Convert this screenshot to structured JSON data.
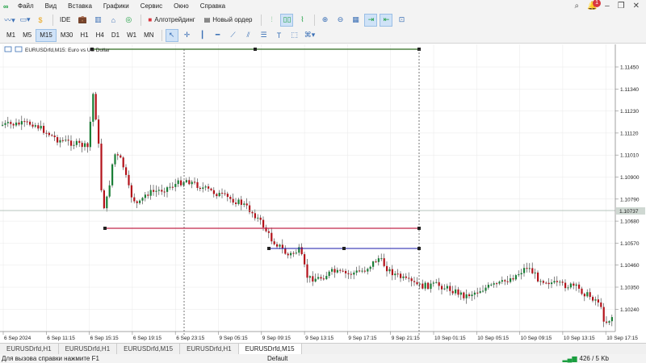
{
  "menu": [
    "Файл",
    "Вид",
    "Вставка",
    "Графики",
    "Сервис",
    "Окно",
    "Справка"
  ],
  "notifications_count": "1",
  "toolbar": {
    "ide_label": "IDE",
    "algo_label": "Алготрейдинг",
    "new_order_label": "Новый ордер"
  },
  "timeframes": [
    "M1",
    "M5",
    "M15",
    "M30",
    "H1",
    "H4",
    "D1",
    "W1",
    "MN"
  ],
  "active_timeframe": "M15",
  "chart": {
    "title": "EURUSDrfd,M15:  Euro vs US Dollar",
    "current_price": "1.10737",
    "price_labels": [
      "1.11450",
      "1.11340",
      "1.11230",
      "1.11120",
      "1.11010",
      "1.10900",
      "1.10790",
      "1.10680",
      "1.10570",
      "1.10460",
      "1.10350",
      "1.10240"
    ],
    "time_labels": [
      "6 Sep 2024",
      "6 Sep 11:15",
      "6 Sep 15:15",
      "6 Sep 19:15",
      "6 Sep 23:15",
      "9 Sep 05:15",
      "9 Sep 09:15",
      "9 Sep 13:15",
      "9 Sep 17:15",
      "9 Sep 21:15",
      "10 Sep 01:15",
      "10 Sep 05:15",
      "10 Sep 09:15",
      "10 Sep 13:15",
      "10 Sep 17:15"
    ],
    "colors": {
      "bull": "#1a7f37",
      "bear": "#b3121a",
      "grid": "#e8e8e8"
    }
  },
  "tabs": [
    "EURUSDrfd,H1",
    "EURUSDrfd,H1",
    "EURUSDrfd,M15",
    "EURUSDrfd,H1",
    "EURUSDrfd,M15"
  ],
  "active_tab": 4,
  "status": {
    "help": "Для вызова справки нажмите F1",
    "profile": "Default",
    "traffic": "426 / 5 Kb"
  }
}
